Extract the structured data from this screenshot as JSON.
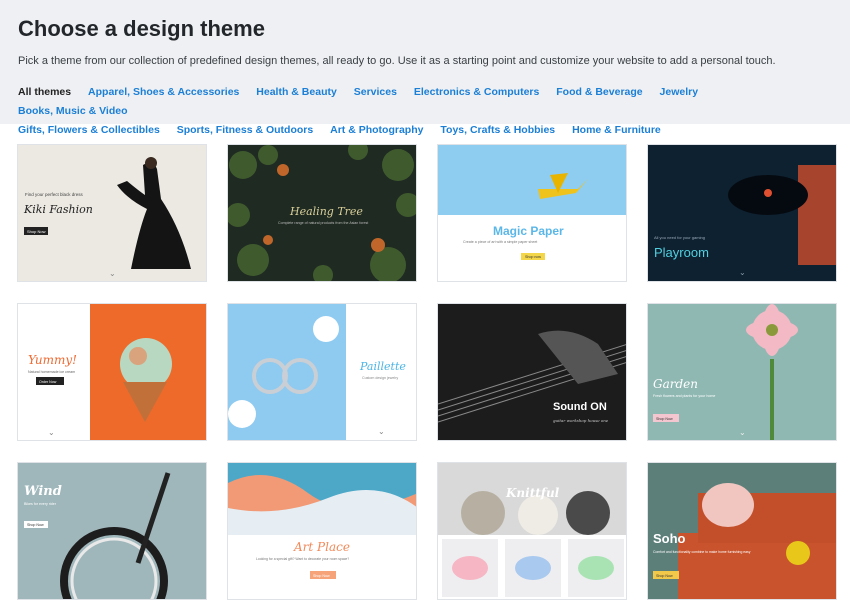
{
  "page": {
    "title": "Choose a design theme",
    "subtitle": "Pick a theme from our collection of predefined design themes, all ready to go. Use it as a starting point and customize your website to add a personal touch."
  },
  "categories": [
    {
      "label": "All themes",
      "active": true
    },
    {
      "label": "Apparel, Shoes & Accessories",
      "active": false
    },
    {
      "label": "Health & Beauty",
      "active": false
    },
    {
      "label": "Services",
      "active": false
    },
    {
      "label": "Electronics & Computers",
      "active": false
    },
    {
      "label": "Food & Beverage",
      "active": false
    },
    {
      "label": "Jewelry",
      "active": false
    },
    {
      "label": "Books, Music & Video",
      "active": false
    },
    {
      "label": "Gifts, Flowers & Collectibles",
      "active": false
    },
    {
      "label": "Sports, Fitness & Outdoors",
      "active": false
    },
    {
      "label": "Art & Photography",
      "active": false
    },
    {
      "label": "Toys, Crafts & Hobbies",
      "active": false
    },
    {
      "label": "Home & Furniture",
      "active": false
    }
  ],
  "themes": [
    {
      "name": "Kiki Fashion",
      "tagline": "Find your perfect black dress",
      "button": "Shop Now"
    },
    {
      "name": "Healing Tree",
      "tagline": "Complete range of natural products from the Asian forest",
      "button": ""
    },
    {
      "name": "Magic Paper",
      "tagline": "Create a piece of art with a simple paper sheet",
      "button": "Shop now"
    },
    {
      "name": "Playroom",
      "tagline": "All you need for your gaming",
      "button": ""
    },
    {
      "name": "Yummy!",
      "tagline": "Natural homemade ice cream",
      "button": "Order Now"
    },
    {
      "name": "Paillette",
      "tagline": "Custom design jewelry",
      "button": ""
    },
    {
      "name": "Sound ON",
      "tagline": "guitar workshop house one",
      "button": ""
    },
    {
      "name": "Garden",
      "tagline": "Fresh flowers and plants for your home",
      "button": "Shop Now"
    },
    {
      "name": "Wind",
      "tagline": "Bikes for every rider",
      "button": "Shop Now"
    },
    {
      "name": "Art Place",
      "tagline": "Looking for a special gift? Want to decorate your room space?",
      "button": "Shop Now"
    },
    {
      "name": "Knittful",
      "tagline": "",
      "button": ""
    },
    {
      "name": "Soho",
      "tagline": "Comfort and functionality combine to make home furnishing easy",
      "button": "Shop Now"
    }
  ],
  "colors": {
    "link": "#1b7fd6",
    "header_bg": "#eef0f3"
  }
}
